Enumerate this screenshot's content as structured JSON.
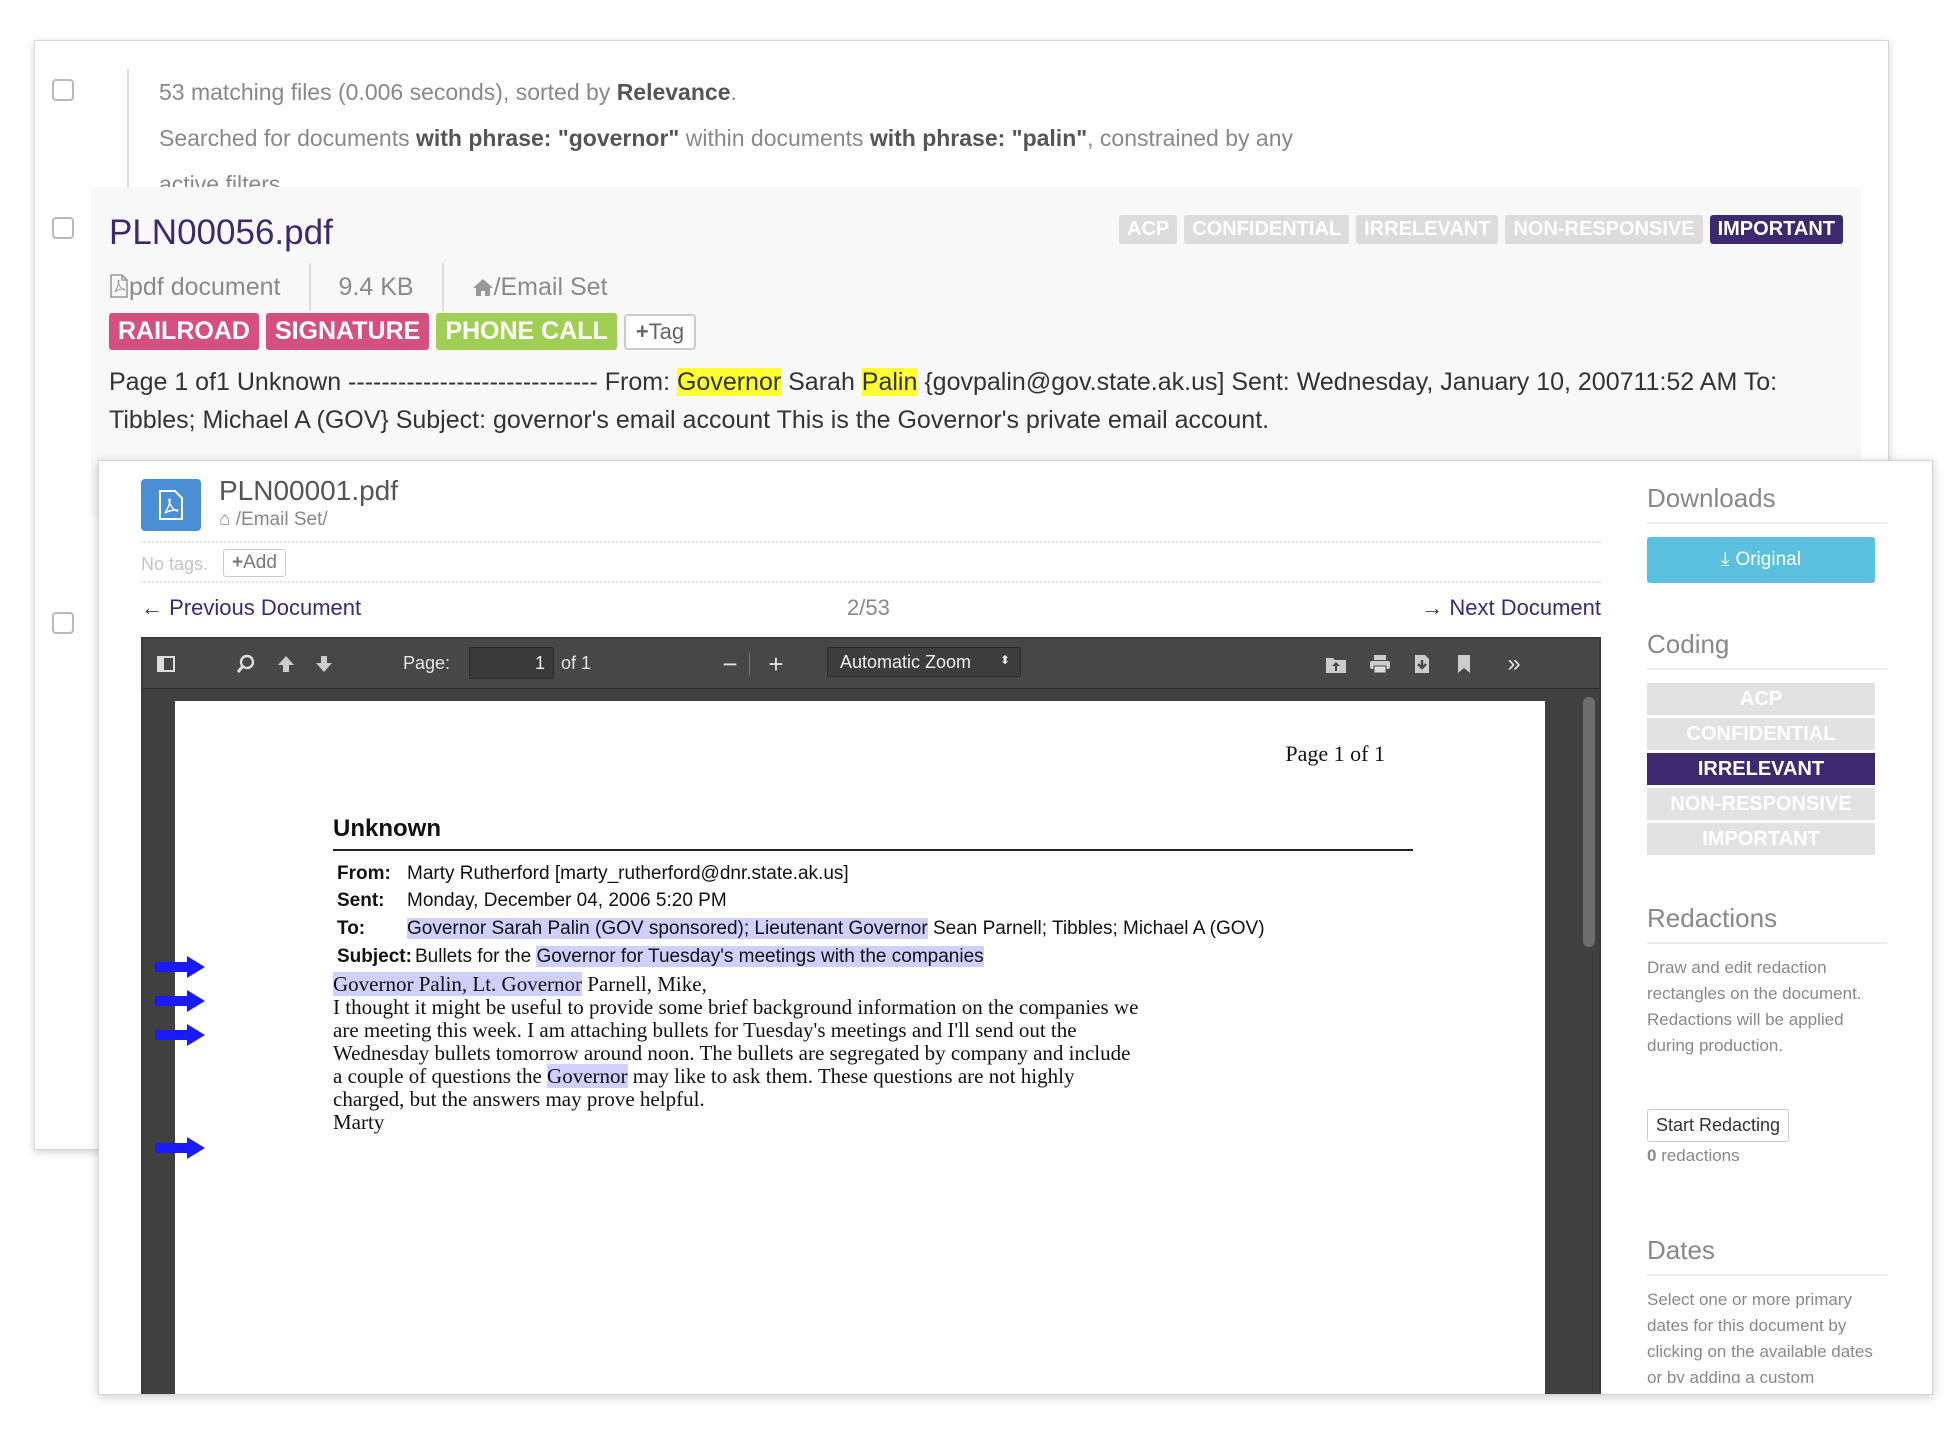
{
  "results": {
    "count_text": "53 matching files (0.006 seconds), sorted by",
    "sort_key": "Relevance",
    "period": ".",
    "search_prefix": "Searched for documents",
    "phrase1_label": "with phrase: \"governor\"",
    "within_text": "within documents",
    "phrase2_label": "with phrase: \"palin\"",
    "constraint_text": ", constrained by any active filters."
  },
  "result_item": {
    "title": "PLN00056.pdf",
    "coding_badges": [
      {
        "label": "ACP",
        "active": false
      },
      {
        "label": "CONFIDENTIAL",
        "active": false
      },
      {
        "label": "IRRELEVANT",
        "active": false
      },
      {
        "label": "NON-RESPONSIVE",
        "active": false
      },
      {
        "label": "IMPORTANT",
        "active": true
      }
    ],
    "file_type": "pdf document",
    "file_size": "9.4 KB",
    "path": "/Email Set",
    "tags": [
      {
        "label": "RAILROAD",
        "color": "#d4507f"
      },
      {
        "label": "SIGNATURE",
        "color": "#d4507f"
      },
      {
        "label": "PHONE CALL",
        "color": "#a0cf56"
      }
    ],
    "add_tag_label": "Tag",
    "snippet": {
      "p1": "Page 1 of1 Unknown ------------------------------ From: ",
      "hl1": "Governor",
      "p2": " Sarah ",
      "hl2": "Palin",
      "p3": " {govpalin@gov.state.ak.us] Sent: Wednesday, January 10, 200711:52 AM To: Tibbles; Michael A (GOV} Subject: governor's email account This is the Governor's private email account."
    }
  },
  "viewer": {
    "title": "PLN00001.pdf",
    "path": "/Email Set/",
    "no_tags": "No tags.",
    "add_label": "Add",
    "prev_label": "Previous Document",
    "position": "2/53",
    "next_label": "Next Document",
    "pdf": {
      "page_label": "Page:",
      "page_value": "1",
      "page_of": "of 1",
      "zoom": "Automatic Zoom"
    },
    "page": {
      "page_header": "Page 1 of 1",
      "heading": "Unknown",
      "from_label": "From:",
      "from_value": "Marty Rutherford [marty_rutherford@dnr.state.ak.us]",
      "sent_label": "Sent:",
      "sent_value": "Monday, December 04, 2006 5:20 PM",
      "to_label": "To:",
      "to_hl": "Governor Sarah Palin (GOV sponsored); Lieutenant Governor",
      "to_rest": " Sean Parnell; Tibbles; Michael A (GOV)",
      "subject_label": "Subject:",
      "subject_plain": "Bullets for the ",
      "subject_hl": "Governor for Tuesday's meetings with the companies",
      "greet_hl1": "Governor Palin, Lt. Governor",
      "greet_rest": " Parnell, Mike,",
      "body1": "I thought it might be useful to provide some brief background information on the companies we",
      "body2": "are meeting this week.  I am attaching bullets for Tuesday's meetings and I'll send out the",
      "body3": "Wednesday bullets tomorrow around noon.  The bullets are segregated by company and include",
      "body4a": "a couple of questions the ",
      "body4hl": "Governor",
      "body4b": " may like to ask them.  These questions are not highly",
      "body5": "charged, but the answers may prove helpful.",
      "sign": "Marty"
    }
  },
  "side": {
    "downloads_title": "Downloads",
    "original_label": "Original",
    "coding_title": "Coding",
    "coding": [
      {
        "label": "ACP",
        "active": false
      },
      {
        "label": "CONFIDENTIAL",
        "active": false
      },
      {
        "label": "IRRELEVANT",
        "active": true
      },
      {
        "label": "NON-RESPONSIVE",
        "active": false
      },
      {
        "label": "IMPORTANT",
        "active": false
      }
    ],
    "redactions_title": "Redactions",
    "redactions_help": "Draw and edit redaction rectangles on the document. Redactions will be applied during production.",
    "start_label": "Start Redacting",
    "redaction_count": "0",
    "redaction_suffix": " redactions",
    "dates_title": "Dates",
    "dates_help": "Select one or more primary dates for this document by clicking on the available dates or by adding a custom"
  },
  "colors": {
    "brand_purple": "#3d2a6e",
    "highlight_yellow": "#ffff33",
    "pdf_highlight": "#cfd0ff",
    "download_blue": "#5bc0de",
    "tag_pink": "#d4507f",
    "tag_green": "#a0cf56",
    "arrow_blue": "#1a1aff"
  }
}
